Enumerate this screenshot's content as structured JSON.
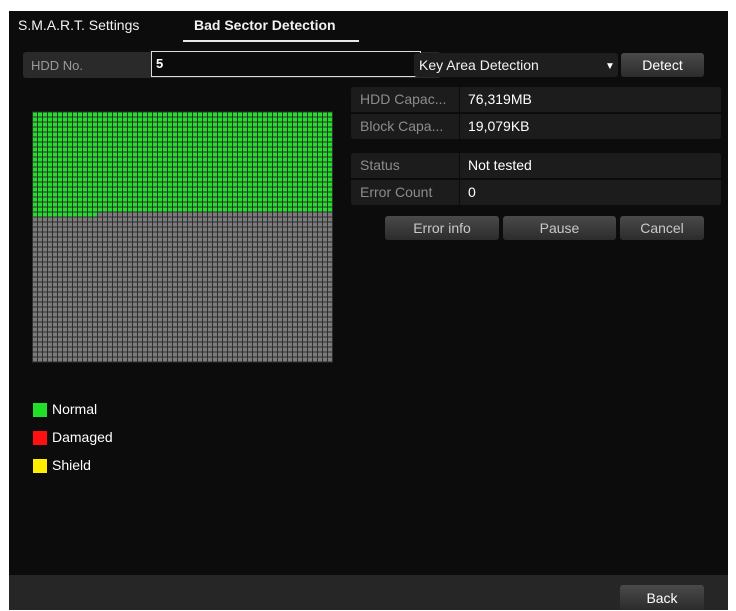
{
  "tabs": [
    {
      "label": "S.M.A.R.T. Settings",
      "active": false
    },
    {
      "label": "Bad Sector Detection",
      "active": true
    }
  ],
  "detect": {
    "hdd_label": "HDD No.",
    "hdd_value": "5",
    "mode_value": "Key Area Detection",
    "detect_label": "Detect"
  },
  "sector_map": {
    "total_blocks": 3000,
    "normal_blocks": 1213,
    "colors": {
      "normal": "#22e02a",
      "damaged": "#ff1111",
      "shield": "#ffee00",
      "untested": "#7c7c7c"
    }
  },
  "capacity": {
    "hdd_capacity_label": "HDD Capac...",
    "hdd_capacity_value": "76,319MB",
    "block_capacity_label": "Block Capa...",
    "block_capacity_value": "19,079KB"
  },
  "status": {
    "status_label": "Status",
    "status_value": "Not tested",
    "error_count_label": "Error Count",
    "error_count_value": "0"
  },
  "actions": {
    "error_info": "Error info",
    "pause": "Pause",
    "cancel": "Cancel"
  },
  "legend": [
    {
      "label": "Normal",
      "color": "#22e02a"
    },
    {
      "label": "Damaged",
      "color": "#ff1111"
    },
    {
      "label": "Shield",
      "color": "#ffee00"
    }
  ],
  "footer": {
    "back": "Back"
  }
}
